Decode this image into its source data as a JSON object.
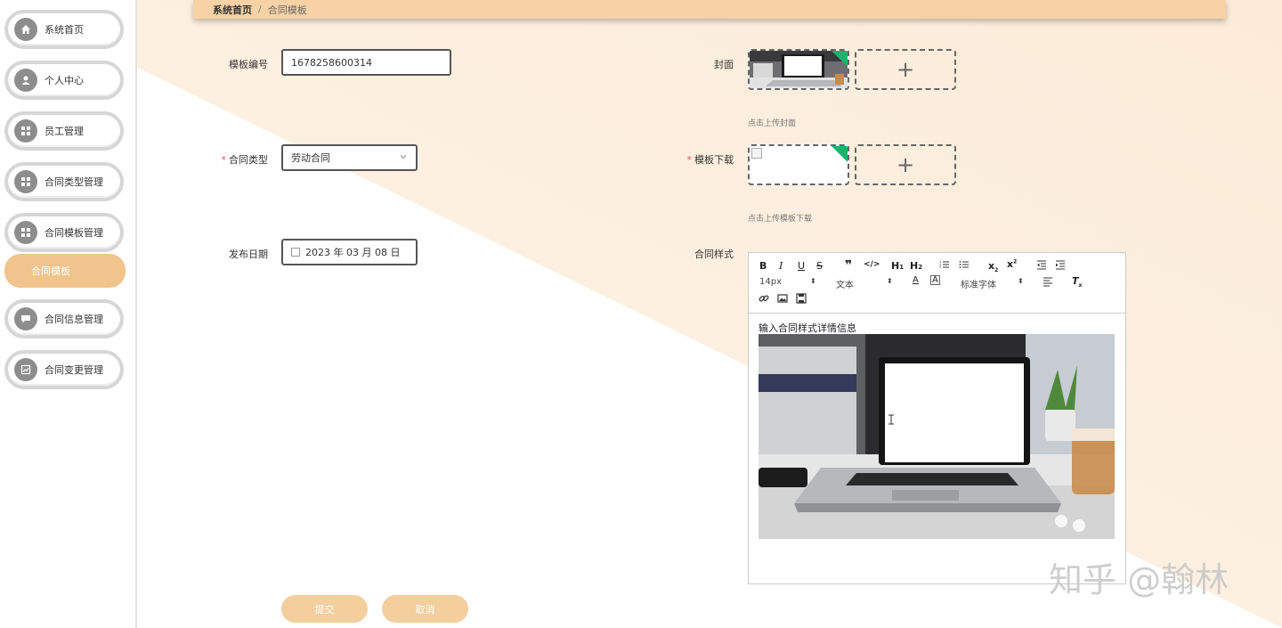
{
  "sidebar": {
    "items": [
      {
        "label": "系统首页",
        "icon": "home-icon"
      },
      {
        "label": "个人中心",
        "icon": "user-icon"
      },
      {
        "label": "员工管理",
        "icon": "grid-icon"
      },
      {
        "label": "合同类型管理",
        "icon": "grid-icon"
      },
      {
        "label": "合同模板管理",
        "icon": "grid-icon"
      },
      {
        "label": "合同信息管理",
        "icon": "chat-icon"
      },
      {
        "label": "合同变更管理",
        "icon": "chart-icon"
      }
    ],
    "subitem": "合同模板"
  },
  "breadcrumb": {
    "home": "系统首页",
    "separator": "/",
    "current": "合同模板"
  },
  "form": {
    "template_no": {
      "label": "模板编号",
      "value": "1678258600314"
    },
    "contract_type": {
      "label": "合同类型",
      "value": "劳动合同"
    },
    "publish_date": {
      "label": "发布日期",
      "value": "2023 年 03 月 08 日"
    },
    "cover": {
      "label": "封面",
      "hint": "点击上传封面"
    },
    "template_download": {
      "label": "模板下载",
      "hint": "点击上传模板下载"
    },
    "contract_style": {
      "label": "合同样式",
      "font_size": "14px",
      "paragraph": "文本",
      "font_family": "标准字体",
      "content_text": "输入合同样式详情信息"
    }
  },
  "buttons": {
    "submit": "提交",
    "cancel": "取消"
  },
  "upload_plus": "+",
  "watermark": "知乎 @翰林",
  "colors": {
    "accent": "#f0c48c",
    "topbar": "#f6d2a5",
    "button": "#f3cf9e",
    "badge": "#19b36b"
  }
}
